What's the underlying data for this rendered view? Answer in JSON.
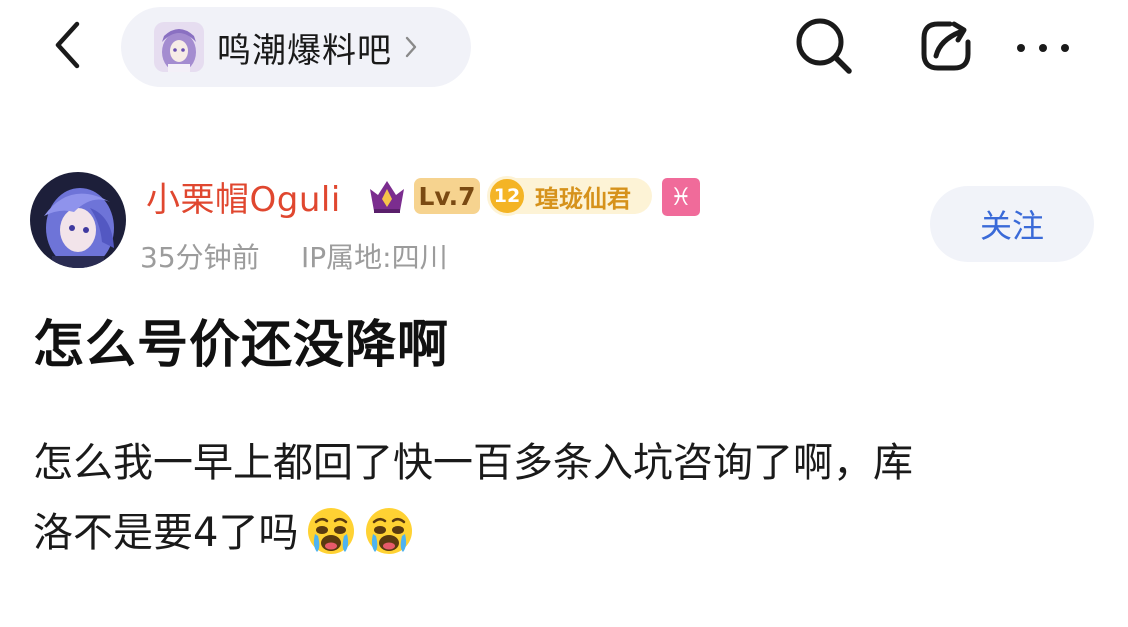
{
  "header": {
    "forum_name": "鸣潮爆料吧",
    "icons": [
      "back-icon",
      "search-icon",
      "share-icon",
      "more-icon"
    ]
  },
  "author": {
    "name": "小栗帽Oguli",
    "level": "Lv.7",
    "title_level": "12",
    "title_name": "瑝珑仙君",
    "zodiac_symbol": "♓",
    "time": "35分钟前",
    "ip_location": "IP属地:四川",
    "follow_label": "关注"
  },
  "post": {
    "title": "怎么号价还没降啊",
    "body_line1": "怎么我一早上都回了快一百多条入坑咨询了啊，库",
    "body_line2": "洛不是要4了吗",
    "emoji_count": 2
  },
  "colors": {
    "author_name": "#e0472f",
    "follow_text": "#3a6ad8",
    "level_badge": "#f6d38f",
    "zodiac_badge": "#f06b9a"
  }
}
